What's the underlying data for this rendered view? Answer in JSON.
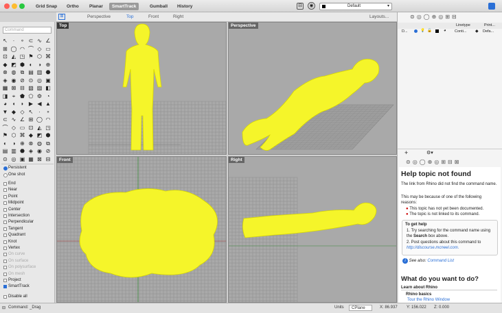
{
  "toolbar": {
    "items": [
      "Grid Snap",
      "Ortho",
      "Planar",
      "SmartTrack",
      "Gumball",
      "History"
    ],
    "active": "SmartTrack",
    "layer_select": "Default"
  },
  "viewtabs": {
    "tabs": [
      "Perspective",
      "Top",
      "Front",
      "Right"
    ],
    "active": "Top",
    "layouts": "Layouts..."
  },
  "sidebar": {
    "command_placeholder": "Command"
  },
  "osnap": {
    "modes": [
      {
        "label": "Persistent",
        "selected": true
      },
      {
        "label": "One shot",
        "selected": false
      }
    ],
    "items": [
      {
        "label": "End",
        "checked": false,
        "enabled": true
      },
      {
        "label": "Near",
        "checked": false,
        "enabled": true
      },
      {
        "label": "Point",
        "checked": false,
        "enabled": true
      },
      {
        "label": "Midpoint",
        "checked": false,
        "enabled": true
      },
      {
        "label": "Center",
        "checked": false,
        "enabled": true
      },
      {
        "label": "Intersection",
        "checked": false,
        "enabled": true
      },
      {
        "label": "Perpendicular",
        "checked": false,
        "enabled": true
      },
      {
        "label": "Tangent",
        "checked": false,
        "enabled": true
      },
      {
        "label": "Quadrant",
        "checked": false,
        "enabled": true
      },
      {
        "label": "Knot",
        "checked": false,
        "enabled": true
      },
      {
        "label": "Vertex",
        "checked": false,
        "enabled": true
      },
      {
        "label": "On curve",
        "checked": false,
        "enabled": false
      },
      {
        "label": "On surface",
        "checked": false,
        "enabled": false
      },
      {
        "label": "On polysurface",
        "checked": false,
        "enabled": false
      },
      {
        "label": "On mesh",
        "checked": false,
        "enabled": false
      },
      {
        "label": "Project",
        "checked": false,
        "enabled": true
      },
      {
        "label": "SmartTrack",
        "checked": true,
        "enabled": true
      }
    ],
    "disable_all": "Disable all"
  },
  "viewports": {
    "top": "Top",
    "perspective": "Perspective",
    "front": "Front",
    "right": "Right"
  },
  "layers": {
    "col_linetype": "Linetype",
    "col_print": "Print...",
    "row_name": "D...",
    "row_linetype": "Conti...",
    "row_print": "Defa..."
  },
  "help": {
    "title": "Help topic not found",
    "p1": "The link from Rhino did not find the command name.",
    "p2": "This may be because of one of the following reasons:",
    "b1": "This topic has not yet been documented.",
    "b2": "The topic is not linked to its command.",
    "gethelp": "To get help",
    "s1": "Try searching for the command name using the",
    "s1b": "Search",
    "s1c": "box above.",
    "s2": "Post questions about this command to",
    "s2link": "http://discourse.mcneel.com.",
    "seealso": "See also:",
    "seealso_link": "Command List",
    "what": "What do you want to do?",
    "learn": "Learn about Rhino",
    "basics": "Rhino basics",
    "tour": "Tour the Rhino Window"
  },
  "status": {
    "command": "Command: _Drag",
    "units": "Units",
    "cplane": "CPlane",
    "x": "X: 86.937",
    "y": "Y: 156.022",
    "z": "Z: 0.000"
  },
  "colors": {
    "accent": "#2a6fd6",
    "yellow": "#f5f52a",
    "viewport_bg": "#a9a9a9"
  }
}
